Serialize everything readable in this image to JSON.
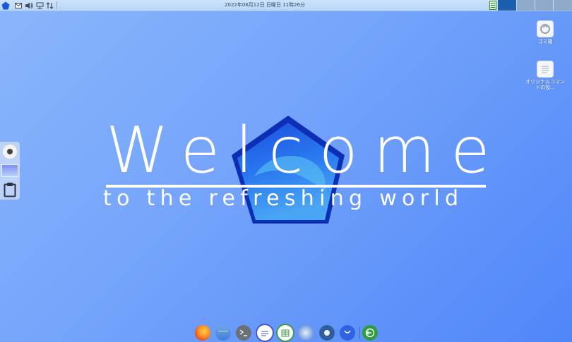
{
  "top_panel": {
    "icons": [
      "pentagon-menu-icon",
      "mail-icon",
      "volume-icon",
      "network-icon",
      "transfer-icon"
    ],
    "clock": "2022年06月12日  日曜日  11時26分",
    "system_monitor_icon": "monitor-icon",
    "workspaces_count": 4
  },
  "desktop_icons": [
    {
      "name": "trash",
      "label": "ゴミ箱"
    },
    {
      "name": "original-command",
      "label": "オリジナルコマンドの設..."
    }
  ],
  "welcome": {
    "title": "Welcome",
    "subtitle": "to the refreshing world"
  },
  "side_dock": {
    "items": [
      "webcam-icon",
      "screenshot-icon",
      "clipboard-icon"
    ]
  },
  "bottom_dock": {
    "items": [
      "firefox-icon",
      "file-manager-icon",
      "terminal-icon",
      "text-editor-icon",
      "spreadsheet-icon",
      "system-tools-icon",
      "settings-toggle-icon",
      "software-store-icon",
      "logout-icon"
    ]
  },
  "colors": {
    "desktop_gradient": [
      "#8ab6fb",
      "#4f86f9"
    ],
    "panel": "#c3dbf8",
    "workspace_active": "#1c5fb0"
  }
}
